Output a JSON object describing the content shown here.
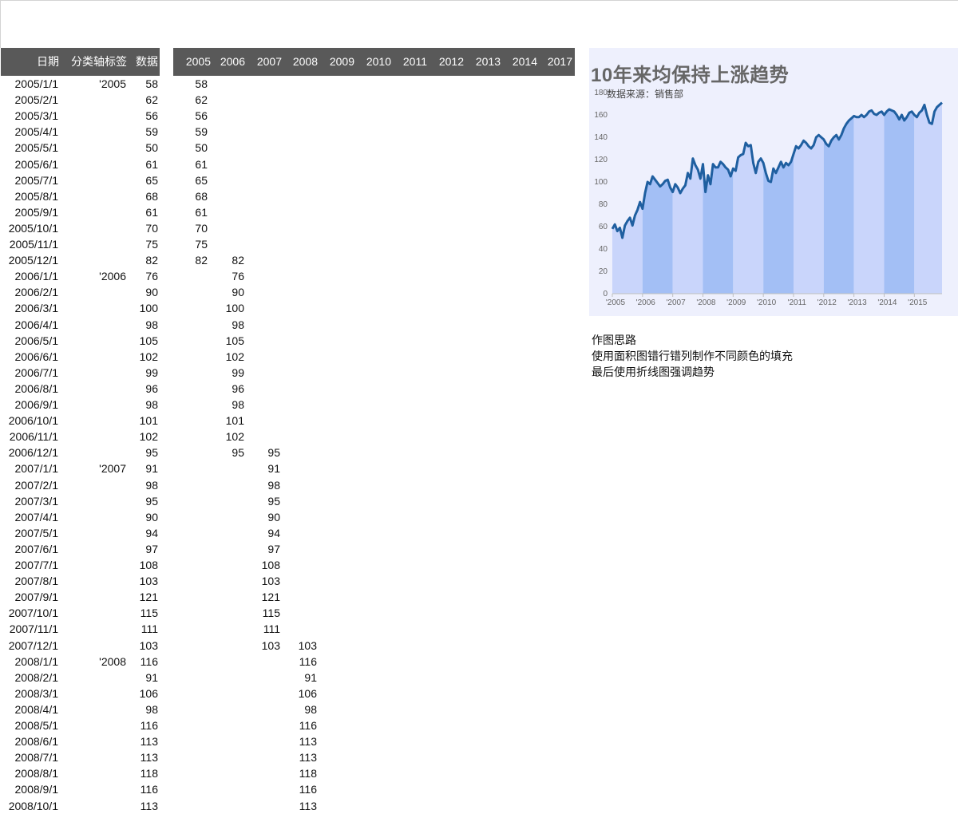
{
  "table": {
    "headers": [
      "日期",
      "分类轴标签",
      "数据"
    ],
    "year_headers": [
      "2005",
      "2006",
      "2007",
      "2008",
      "2009",
      "2010",
      "2011",
      "2012",
      "2013",
      "2014",
      "2017"
    ],
    "rows": [
      {
        "date": "2005/1/1",
        "label": "'2005",
        "value": "58",
        "cols": {
          "0": "58"
        }
      },
      {
        "date": "2005/2/1",
        "label": "",
        "value": "62",
        "cols": {
          "0": "62"
        }
      },
      {
        "date": "2005/3/1",
        "label": "",
        "value": "56",
        "cols": {
          "0": "56"
        }
      },
      {
        "date": "2005/4/1",
        "label": "",
        "value": "59",
        "cols": {
          "0": "59"
        }
      },
      {
        "date": "2005/5/1",
        "label": "",
        "value": "50",
        "cols": {
          "0": "50"
        }
      },
      {
        "date": "2005/6/1",
        "label": "",
        "value": "61",
        "cols": {
          "0": "61"
        }
      },
      {
        "date": "2005/7/1",
        "label": "",
        "value": "65",
        "cols": {
          "0": "65"
        }
      },
      {
        "date": "2005/8/1",
        "label": "",
        "value": "68",
        "cols": {
          "0": "68"
        }
      },
      {
        "date": "2005/9/1",
        "label": "",
        "value": "61",
        "cols": {
          "0": "61"
        }
      },
      {
        "date": "2005/10/1",
        "label": "",
        "value": "70",
        "cols": {
          "0": "70"
        }
      },
      {
        "date": "2005/11/1",
        "label": "",
        "value": "75",
        "cols": {
          "0": "75"
        }
      },
      {
        "date": "2005/12/1",
        "label": "",
        "value": "82",
        "cols": {
          "0": "82",
          "1": "82"
        }
      },
      {
        "date": "2006/1/1",
        "label": "'2006",
        "value": "76",
        "cols": {
          "1": "76"
        }
      },
      {
        "date": "2006/2/1",
        "label": "",
        "value": "90",
        "cols": {
          "1": "90"
        }
      },
      {
        "date": "2006/3/1",
        "label": "",
        "value": "100",
        "cols": {
          "1": "100"
        }
      },
      {
        "date": "2006/4/1",
        "label": "",
        "value": "98",
        "cols": {
          "1": "98"
        }
      },
      {
        "date": "2006/5/1",
        "label": "",
        "value": "105",
        "cols": {
          "1": "105"
        }
      },
      {
        "date": "2006/6/1",
        "label": "",
        "value": "102",
        "cols": {
          "1": "102"
        }
      },
      {
        "date": "2006/7/1",
        "label": "",
        "value": "99",
        "cols": {
          "1": "99"
        }
      },
      {
        "date": "2006/8/1",
        "label": "",
        "value": "96",
        "cols": {
          "1": "96"
        }
      },
      {
        "date": "2006/9/1",
        "label": "",
        "value": "98",
        "cols": {
          "1": "98"
        }
      },
      {
        "date": "2006/10/1",
        "label": "",
        "value": "101",
        "cols": {
          "1": "101"
        }
      },
      {
        "date": "2006/11/1",
        "label": "",
        "value": "102",
        "cols": {
          "1": "102"
        }
      },
      {
        "date": "2006/12/1",
        "label": "",
        "value": "95",
        "cols": {
          "1": "95",
          "2": "95"
        }
      },
      {
        "date": "2007/1/1",
        "label": "'2007",
        "value": "91",
        "cols": {
          "2": "91"
        }
      },
      {
        "date": "2007/2/1",
        "label": "",
        "value": "98",
        "cols": {
          "2": "98"
        }
      },
      {
        "date": "2007/3/1",
        "label": "",
        "value": "95",
        "cols": {
          "2": "95"
        }
      },
      {
        "date": "2007/4/1",
        "label": "",
        "value": "90",
        "cols": {
          "2": "90"
        }
      },
      {
        "date": "2007/5/1",
        "label": "",
        "value": "94",
        "cols": {
          "2": "94"
        }
      },
      {
        "date": "2007/6/1",
        "label": "",
        "value": "97",
        "cols": {
          "2": "97"
        }
      },
      {
        "date": "2007/7/1",
        "label": "",
        "value": "108",
        "cols": {
          "2": "108"
        }
      },
      {
        "date": "2007/8/1",
        "label": "",
        "value": "103",
        "cols": {
          "2": "103"
        }
      },
      {
        "date": "2007/9/1",
        "label": "",
        "value": "121",
        "cols": {
          "2": "121"
        }
      },
      {
        "date": "2007/10/1",
        "label": "",
        "value": "115",
        "cols": {
          "2": "115"
        }
      },
      {
        "date": "2007/11/1",
        "label": "",
        "value": "111",
        "cols": {
          "2": "111"
        }
      },
      {
        "date": "2007/12/1",
        "label": "",
        "value": "103",
        "cols": {
          "2": "103",
          "3": "103"
        }
      },
      {
        "date": "2008/1/1",
        "label": "'2008",
        "value": "116",
        "cols": {
          "3": "116"
        }
      },
      {
        "date": "2008/2/1",
        "label": "",
        "value": "91",
        "cols": {
          "3": "91"
        }
      },
      {
        "date": "2008/3/1",
        "label": "",
        "value": "106",
        "cols": {
          "3": "106"
        }
      },
      {
        "date": "2008/4/1",
        "label": "",
        "value": "98",
        "cols": {
          "3": "98"
        }
      },
      {
        "date": "2008/5/1",
        "label": "",
        "value": "116",
        "cols": {
          "3": "116"
        }
      },
      {
        "date": "2008/6/1",
        "label": "",
        "value": "113",
        "cols": {
          "3": "113"
        }
      },
      {
        "date": "2008/7/1",
        "label": "",
        "value": "113",
        "cols": {
          "3": "113"
        }
      },
      {
        "date": "2008/8/1",
        "label": "",
        "value": "118",
        "cols": {
          "3": "118"
        }
      },
      {
        "date": "2008/9/1",
        "label": "",
        "value": "116",
        "cols": {
          "3": "116"
        }
      },
      {
        "date": "2008/10/1",
        "label": "",
        "value": "113",
        "cols": {
          "3": "113"
        }
      }
    ]
  },
  "chart": {
    "title": "10年来均保持上涨趋势",
    "subtitle": "数据来源：销售部"
  },
  "notes": [
    "作图思路",
    "使用面积图错行错列制作不同颜色的填充",
    "最后使用折线图强调趋势"
  ],
  "colors": {
    "header_bg": "#595959",
    "chart_bg": "#eef0fd",
    "band_light": "#c9d5fb",
    "band_dark": "#a3bff5",
    "line": "#1f5fa0"
  },
  "chart_data": {
    "type": "line",
    "title": "10年来均保持上涨趋势",
    "subtitle": "数据来源：销售部",
    "ylim": [
      0,
      180
    ],
    "yticks": [
      0,
      20,
      40,
      60,
      80,
      100,
      120,
      140,
      160,
      180
    ],
    "xtick_labels": [
      "'2005",
      "'2006",
      "'2007",
      "'2008",
      "'2009",
      "'2010",
      "'2011",
      "'2012",
      "'2013",
      "'2014",
      "'2015"
    ],
    "series": [
      {
        "values": [
          58,
          62,
          56,
          59,
          50,
          61,
          65,
          68,
          61,
          70,
          75,
          82,
          76,
          90,
          100,
          98,
          105,
          102,
          99,
          96,
          98,
          101,
          102,
          95,
          91,
          98,
          95,
          90,
          94,
          97,
          108,
          103,
          121,
          115,
          111,
          103,
          116,
          91,
          106,
          98,
          116,
          113,
          113,
          118,
          116,
          113,
          111,
          105,
          112,
          110,
          122,
          124,
          125,
          135,
          132,
          133,
          117,
          108,
          118,
          121,
          117,
          108,
          101,
          100,
          112,
          108,
          113,
          118,
          113,
          117,
          115,
          118,
          125,
          132,
          130,
          133,
          137,
          135,
          132,
          130,
          133,
          140,
          142,
          140,
          138,
          134,
          132,
          137,
          140,
          142,
          138,
          142,
          148,
          152,
          155,
          157,
          159,
          158,
          158,
          160,
          158,
          160,
          163,
          164,
          161,
          160,
          162,
          163,
          160,
          163,
          165,
          164,
          163,
          160,
          156,
          160,
          155,
          158,
          162,
          163,
          160,
          158,
          162,
          164,
          169,
          160,
          153,
          152,
          163,
          167,
          169,
          171
        ]
      }
    ],
    "bands": "alternating fill by year",
    "grid": false,
    "legend": "none"
  }
}
